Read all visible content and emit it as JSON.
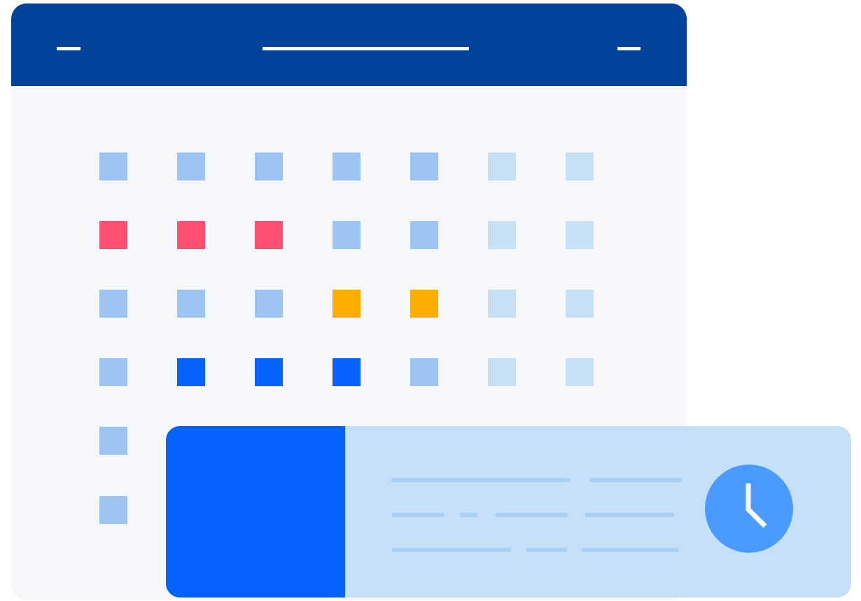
{
  "colors": {
    "header": "#00419c",
    "body": "#f5f7fb",
    "header_bar": "#ffffff",
    "day_future": "#c7e0f6",
    "day_past": "#9dc5f3",
    "event_red": "#ff5071",
    "event_orange": "#ffac00",
    "event_blue": "#0563fe",
    "card_bg": "#c5e0f7",
    "card_thumb": "#0563fe",
    "card_line": "#a9d0f5",
    "clock": "#4b9bff",
    "clock_hands": "#ffffff"
  },
  "calendar": {
    "weeks": [
      [
        "past",
        "past",
        "past",
        "past",
        "past",
        "future",
        "future"
      ],
      [
        "event_red",
        "event_red",
        "event_red",
        "past",
        "past",
        "future",
        "future"
      ],
      [
        "past",
        "past",
        "past",
        "event_orange",
        "event_orange",
        "future",
        "future"
      ],
      [
        "past",
        "event_blue",
        "event_blue",
        "event_blue",
        "past",
        "future",
        "future"
      ],
      [
        "past"
      ],
      [
        "past"
      ]
    ]
  },
  "event_card": {
    "icon": "clock-icon"
  }
}
